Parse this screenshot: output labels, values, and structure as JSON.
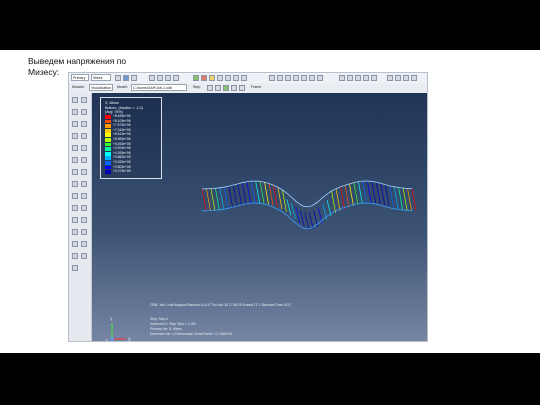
{
  "caption": {
    "line1": "Выведем напряжения по",
    "line2": "Мизесу:"
  },
  "toolbar": {
    "dropdown_left": "Primary",
    "dropdown_mid": "Mises",
    "module_label": "Module:",
    "module_value": "Visualization",
    "model_label": "Model:",
    "model_value": "C:/Users/AAP/Job-1.odb",
    "step_label": "Step",
    "frame_label": "Frame"
  },
  "legend": {
    "title1": "S, Mises",
    "title2": "Bottom, (fraction = -1.0)",
    "title3": "(Avg: 75%)",
    "values": [
      "+8.633e+06",
      "+8.103e+06",
      "+7.573e+06",
      "+7.043e+06",
      "+6.513e+06",
      "+5.983e+06",
      "+5.453e+06",
      "+4.923e+06",
      "+4.393e+06",
      "+3.863e+06",
      "+3.333e+06",
      "+2.803e+06",
      "+2.273e+06"
    ],
    "colors": [
      "#ff0000",
      "#ff4d00",
      "#ff9900",
      "#ffcc00",
      "#ffff00",
      "#b3ff00",
      "#33ff33",
      "#00ff99",
      "#00ffff",
      "#00b3ff",
      "#0066ff",
      "#0000ff",
      "#0000b3"
    ]
  },
  "status": {
    "line1": "ODB: Job-1.odb    Abaqus/Standard 6.14-5    Thu Nov 30 17:48:25 Russia TZ 1 Standard Time 2017",
    "line2": "Step: Step-1",
    "line3": "Increment    1: Step Time =    1.000",
    "line4": "Primary Var: S, Mises",
    "line5": "Deformed Var: U   Deformation Scale Factor: +2.188e+00"
  },
  "triad": {
    "y": "Y",
    "x": "X",
    "z": "Z"
  },
  "colors": {
    "accent": "#1f3457",
    "mesh": "#3aa0ff"
  }
}
